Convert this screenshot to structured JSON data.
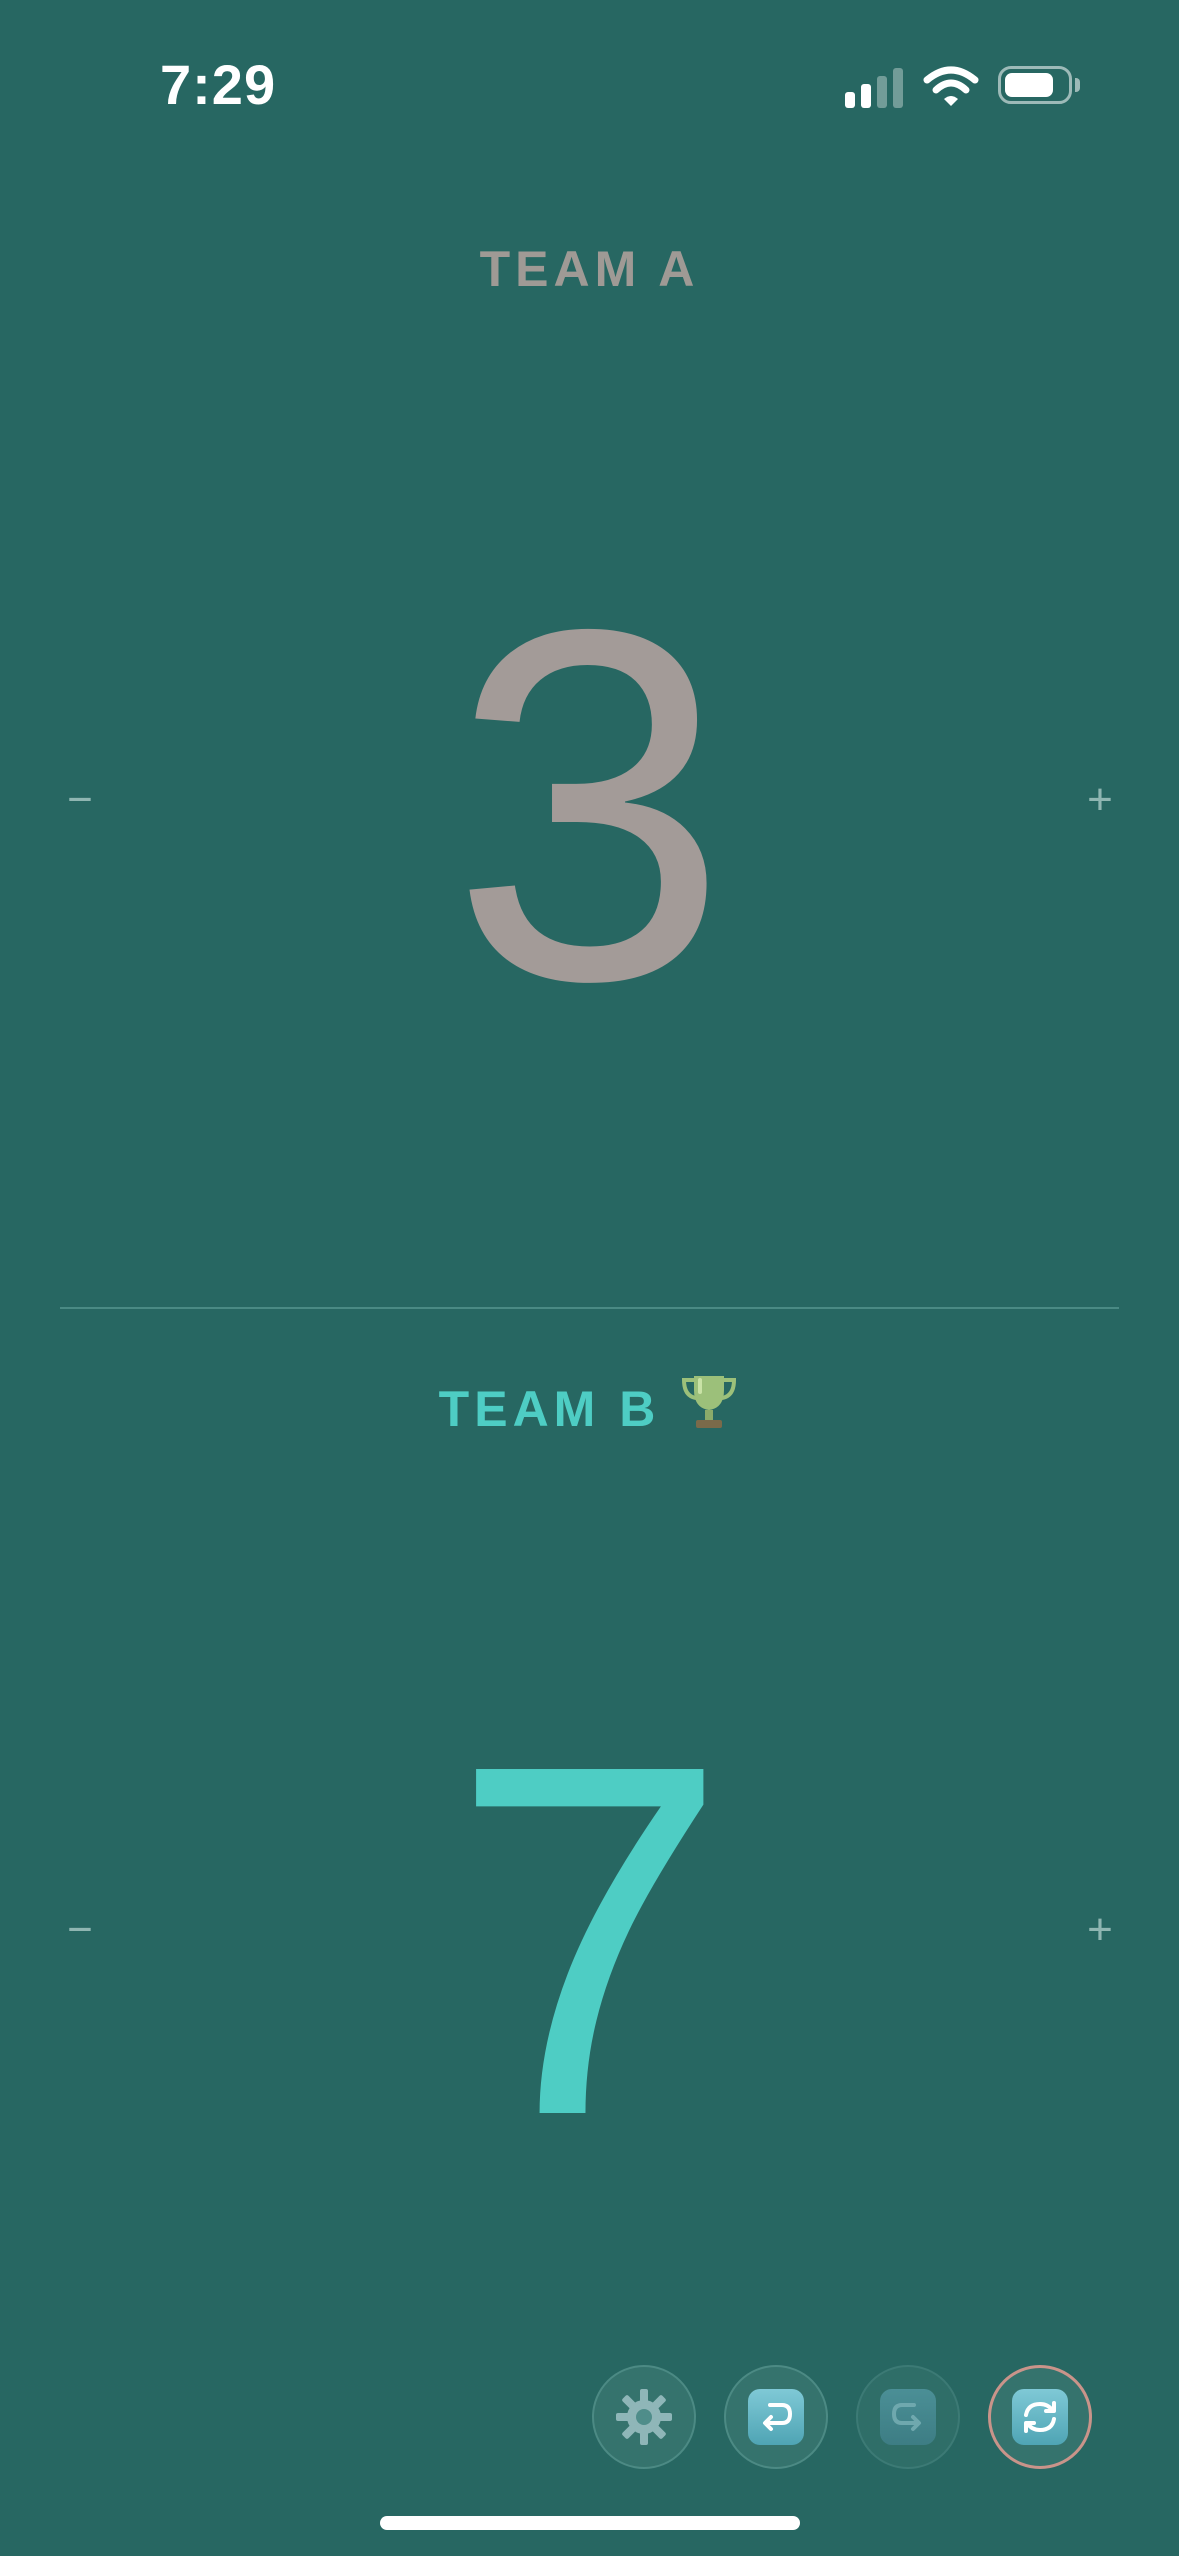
{
  "status_bar": {
    "time": "7:29",
    "signal_icon": "cellular-signal-icon",
    "wifi_icon": "wifi-icon",
    "battery_icon": "battery-icon"
  },
  "team_a": {
    "name": "TEAM A",
    "score": "3",
    "minus_label": "−",
    "plus_label": "+",
    "color": "#a39b98"
  },
  "team_b": {
    "name": "TEAM B",
    "trophy": "🏆",
    "score": "7",
    "minus_label": "−",
    "plus_label": "+",
    "color": "#4ecdc4"
  },
  "toolbar": {
    "buttons": [
      {
        "icon": "gear-icon",
        "enabled": true
      },
      {
        "icon": "undo-icon",
        "enabled": true
      },
      {
        "icon": "redo-icon",
        "enabled": false
      },
      {
        "icon": "swap-icon",
        "enabled": true
      }
    ]
  },
  "colors": {
    "background": "#276762",
    "leading_team": "#4ecdc4",
    "trailing_team": "#a39b98"
  }
}
